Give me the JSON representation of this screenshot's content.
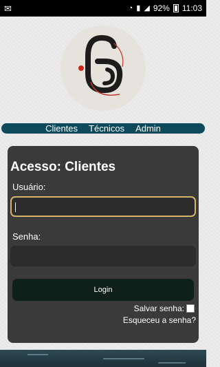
{
  "statusbar": {
    "battery": "92%",
    "time": "11:03"
  },
  "nav": {
    "items": [
      "Clientes",
      "Técnicos",
      "Admin"
    ]
  },
  "login": {
    "title": "Acesso: Clientes",
    "username_label": "Usuário:",
    "password_label": "Senha:",
    "button_label": "Login",
    "save_password_label": "Salvar senha:",
    "forgot_password_label": "Esqueceu a senha?"
  },
  "colors": {
    "nav_bg": "#0e4a5c",
    "card_bg": "#3a3a3a",
    "focus_border": "#d6b46a",
    "login_btn": "#0f1f1a"
  }
}
